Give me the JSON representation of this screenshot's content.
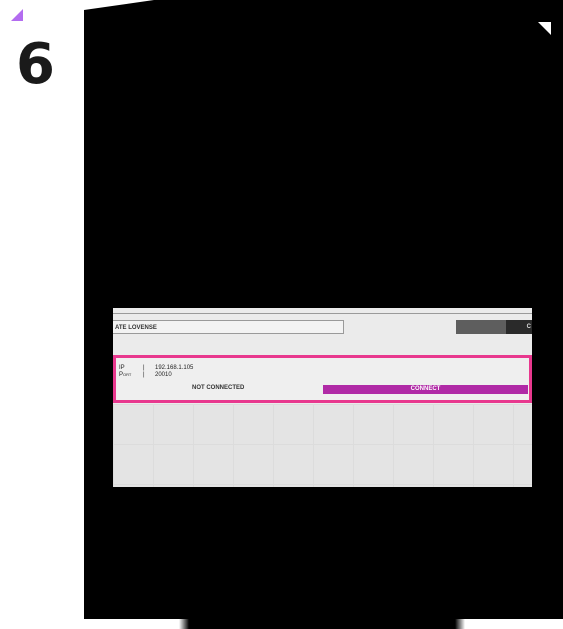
{
  "step": {
    "number": "6"
  },
  "panel": {
    "search_value": "ATE LOVENSE",
    "right_button_label": "C",
    "device": {
      "ip_label": "IP",
      "ip_sep": "|",
      "ip_value": "192.168.1.105",
      "port_label": "Port",
      "port_sep": "|",
      "port_value": "20010",
      "status": "NOT CONNECTED",
      "connect_label": "CONNECT"
    }
  },
  "colors": {
    "accent_pink": "#e8388e",
    "connect_purple": "#b02aa6",
    "corner_purple": "#b36cf0"
  }
}
